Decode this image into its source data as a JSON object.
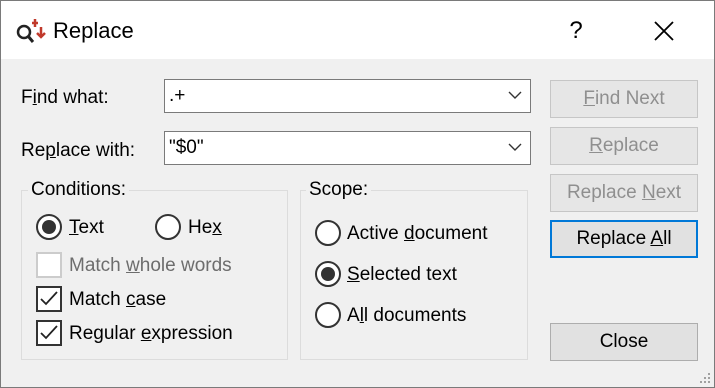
{
  "window": {
    "title": "Replace",
    "help": "?"
  },
  "find": {
    "label_pre": "F",
    "label_key": "i",
    "label_post": "nd what:",
    "value": ".+"
  },
  "replace": {
    "label_pre": "Re",
    "label_key": "p",
    "label_post": "lace with:",
    "value": "\"$0\""
  },
  "conditions": {
    "title": "Conditions:",
    "text": {
      "key": "T",
      "rest": "ext",
      "selected": true
    },
    "hex": {
      "pre": "He",
      "key": "x",
      "selected": false
    },
    "match_whole_words": {
      "pre": "Match ",
      "key": "w",
      "post": "hole words",
      "checked": false,
      "enabled": false
    },
    "match_case": {
      "pre": "Match ",
      "key": "c",
      "post": "ase",
      "checked": true
    },
    "regular_expression": {
      "pre": "Regular ",
      "key": "e",
      "post": "xpression",
      "checked": true
    }
  },
  "scope": {
    "title": "Scope:",
    "active_document": {
      "pre": "Active ",
      "key": "d",
      "post": "ocument",
      "selected": false
    },
    "selected_text": {
      "pre": "",
      "key": "S",
      "post": "elected text",
      "selected": true
    },
    "all_documents": {
      "pre": "A",
      "key": "l",
      "post": "l documents",
      "selected": false
    }
  },
  "buttons": {
    "find_next": {
      "key": "F",
      "rest": "ind Next",
      "enabled": false
    },
    "replace": {
      "key": "R",
      "rest": "eplace",
      "enabled": false
    },
    "replace_next": {
      "pre": "Replace ",
      "key": "N",
      "post": "ext",
      "enabled": false
    },
    "replace_all": {
      "pre": "Replace ",
      "key": "A",
      "post": "ll",
      "enabled": true
    },
    "close": "Close"
  },
  "icons": {
    "app": "find-replace-icon",
    "close": "close-icon",
    "dropdown": "chevron-down-icon",
    "check": "checkmark-icon",
    "grip": "resize-grip-icon"
  },
  "colors": {
    "dialog_bg": "#f0f0f0",
    "focus_border": "#0078d7",
    "disabled_text": "#8f8f8f"
  }
}
